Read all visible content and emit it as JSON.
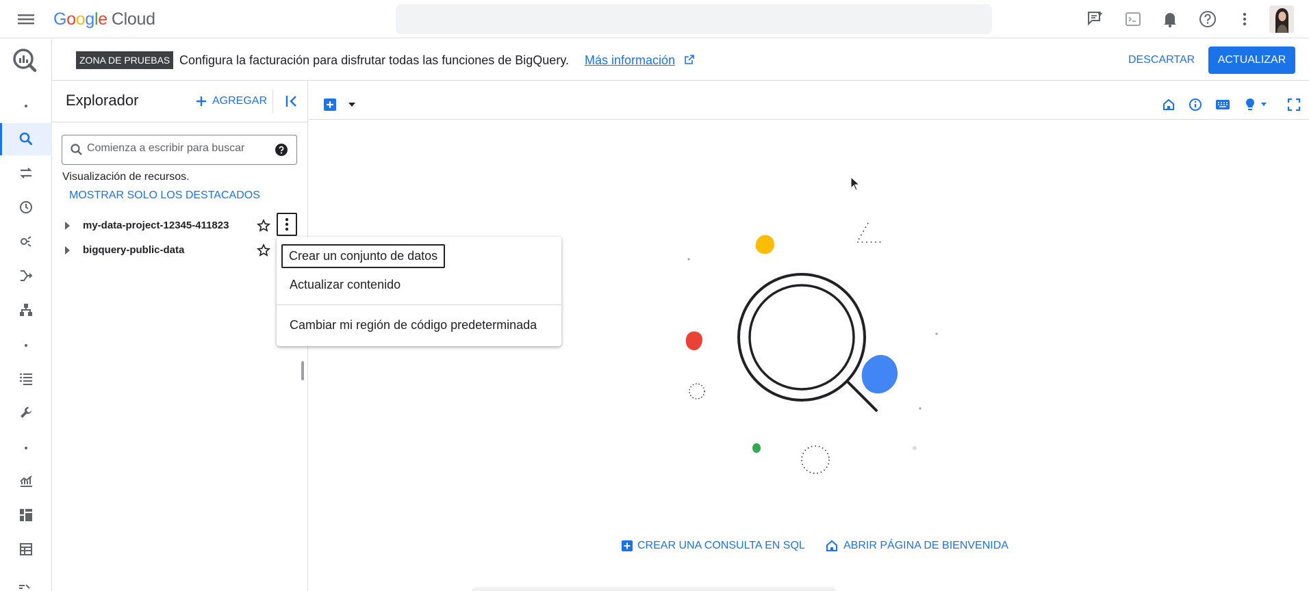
{
  "topbar": {
    "logo_google": "Google",
    "logo_cloud": "Cloud",
    "icons": [
      "menu-icon",
      "feedback-icon",
      "terminal-icon",
      "notifications-icon",
      "help-icon",
      "more-vert-icon",
      "avatar"
    ]
  },
  "banner": {
    "badge": "ZONA DE PRUEBAS",
    "text": "Configura la facturación para disfrutar todas las funciones de BigQuery.",
    "link": "Más información",
    "dismiss": "DESCARTAR",
    "update": "ACTUALIZAR"
  },
  "explorer": {
    "title": "Explorador",
    "add": "AGREGAR",
    "search_placeholder": "Comienza a escribir para buscar",
    "visibility_text": "Visualización de recursos.",
    "starred_link": "MOSTRAR SOLO LOS DESTACADOS",
    "projects": [
      {
        "name": "my-data-project-12345-411823"
      },
      {
        "name": "bigquery-public-data"
      }
    ]
  },
  "context_menu": {
    "items": [
      "Crear un conjunto de datos",
      "Actualizar contenido",
      "Cambiar mi región de código predeterminada"
    ]
  },
  "workspace": {
    "create_sql": "CREAR UNA CONSULTA EN SQL",
    "open_welcome": "ABRIR PÁGINA DE BIENVENIDA"
  },
  "colors": {
    "primary": "#1a73e8",
    "google_blue": "#4285f4",
    "google_red": "#ea4335",
    "google_yellow": "#fbbc04",
    "google_green": "#34a853"
  }
}
